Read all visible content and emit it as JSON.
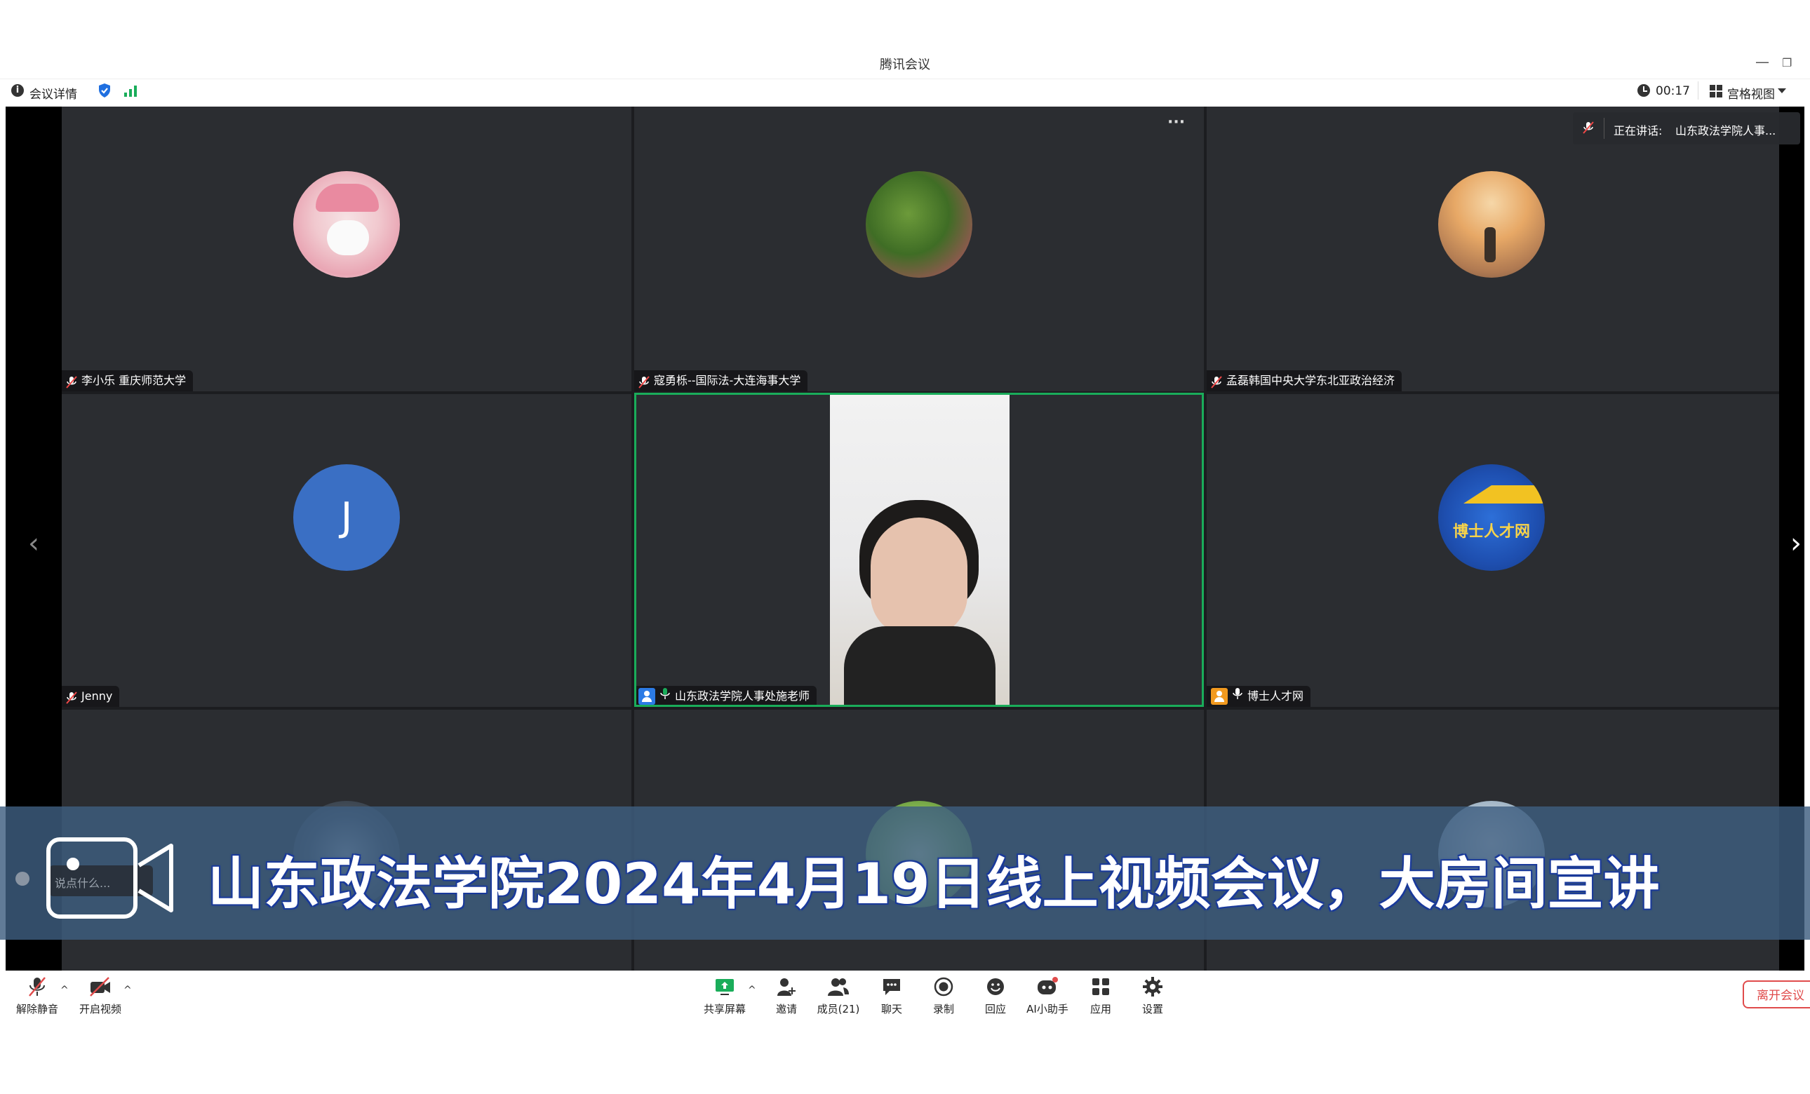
{
  "window": {
    "title": "腾讯会议"
  },
  "infobar": {
    "details_label": "会议详情",
    "timer": "00:17",
    "view_label": "宫格视图"
  },
  "speaking": {
    "label": "正在讲话:",
    "name": "山东政法学院人事..."
  },
  "participants": [
    {
      "name": "李小乐 重庆师范大学",
      "mic": "muted"
    },
    {
      "name": "寇勇栎--国际法-大连海事大学",
      "mic": "muted"
    },
    {
      "name": "孟磊韩国中央大学东北亚政治经济",
      "mic": "muted"
    },
    {
      "name": "Jenny",
      "mic": "muted",
      "initial": "J"
    },
    {
      "name": "山东政法学院人事处施老师",
      "mic": "on",
      "host": true
    },
    {
      "name": "博士人才网",
      "mic": "on",
      "logo_text": "博士人才网"
    }
  ],
  "chat_placeholder": "说点什么...",
  "banner": {
    "text": "山东政法学院2024年4月19日线上视频会议，大房间宣讲"
  },
  "toolbar": {
    "unmute": "解除静音",
    "start_video": "开启视频",
    "share_screen": "共享屏幕",
    "invite": "邀请",
    "members": "成员(21)",
    "chat": "聊天",
    "record": "录制",
    "reactions": "回应",
    "ai_assistant": "AI小助手",
    "apps": "应用",
    "settings": "设置",
    "leave": "离开会议"
  },
  "colors": {
    "accent_green": "#1aad5a",
    "leave_red": "#e04b4b",
    "avatar_blue": "#3a6fc4"
  }
}
